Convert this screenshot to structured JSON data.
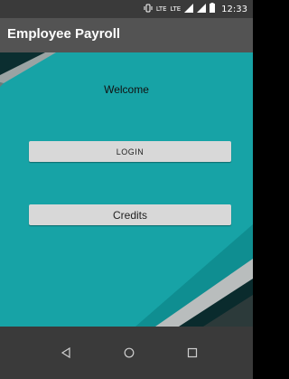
{
  "status_bar": {
    "time": "12:33",
    "network_labels": [
      "LTE",
      "LTE"
    ],
    "icons": [
      "vibrate-icon",
      "volte-icon",
      "lte-icon",
      "signal-icon",
      "signal-icon",
      "battery-icon"
    ]
  },
  "app_bar": {
    "title": "Employee Payroll",
    "color": "#535353"
  },
  "main": {
    "welcome_text": "Welcome",
    "login_label": "LOGIN",
    "credits_label": "Credits",
    "background_color": "#17a3a6"
  },
  "nav_bar": {
    "icons": [
      "back-icon",
      "home-icon",
      "recents-icon"
    ]
  }
}
